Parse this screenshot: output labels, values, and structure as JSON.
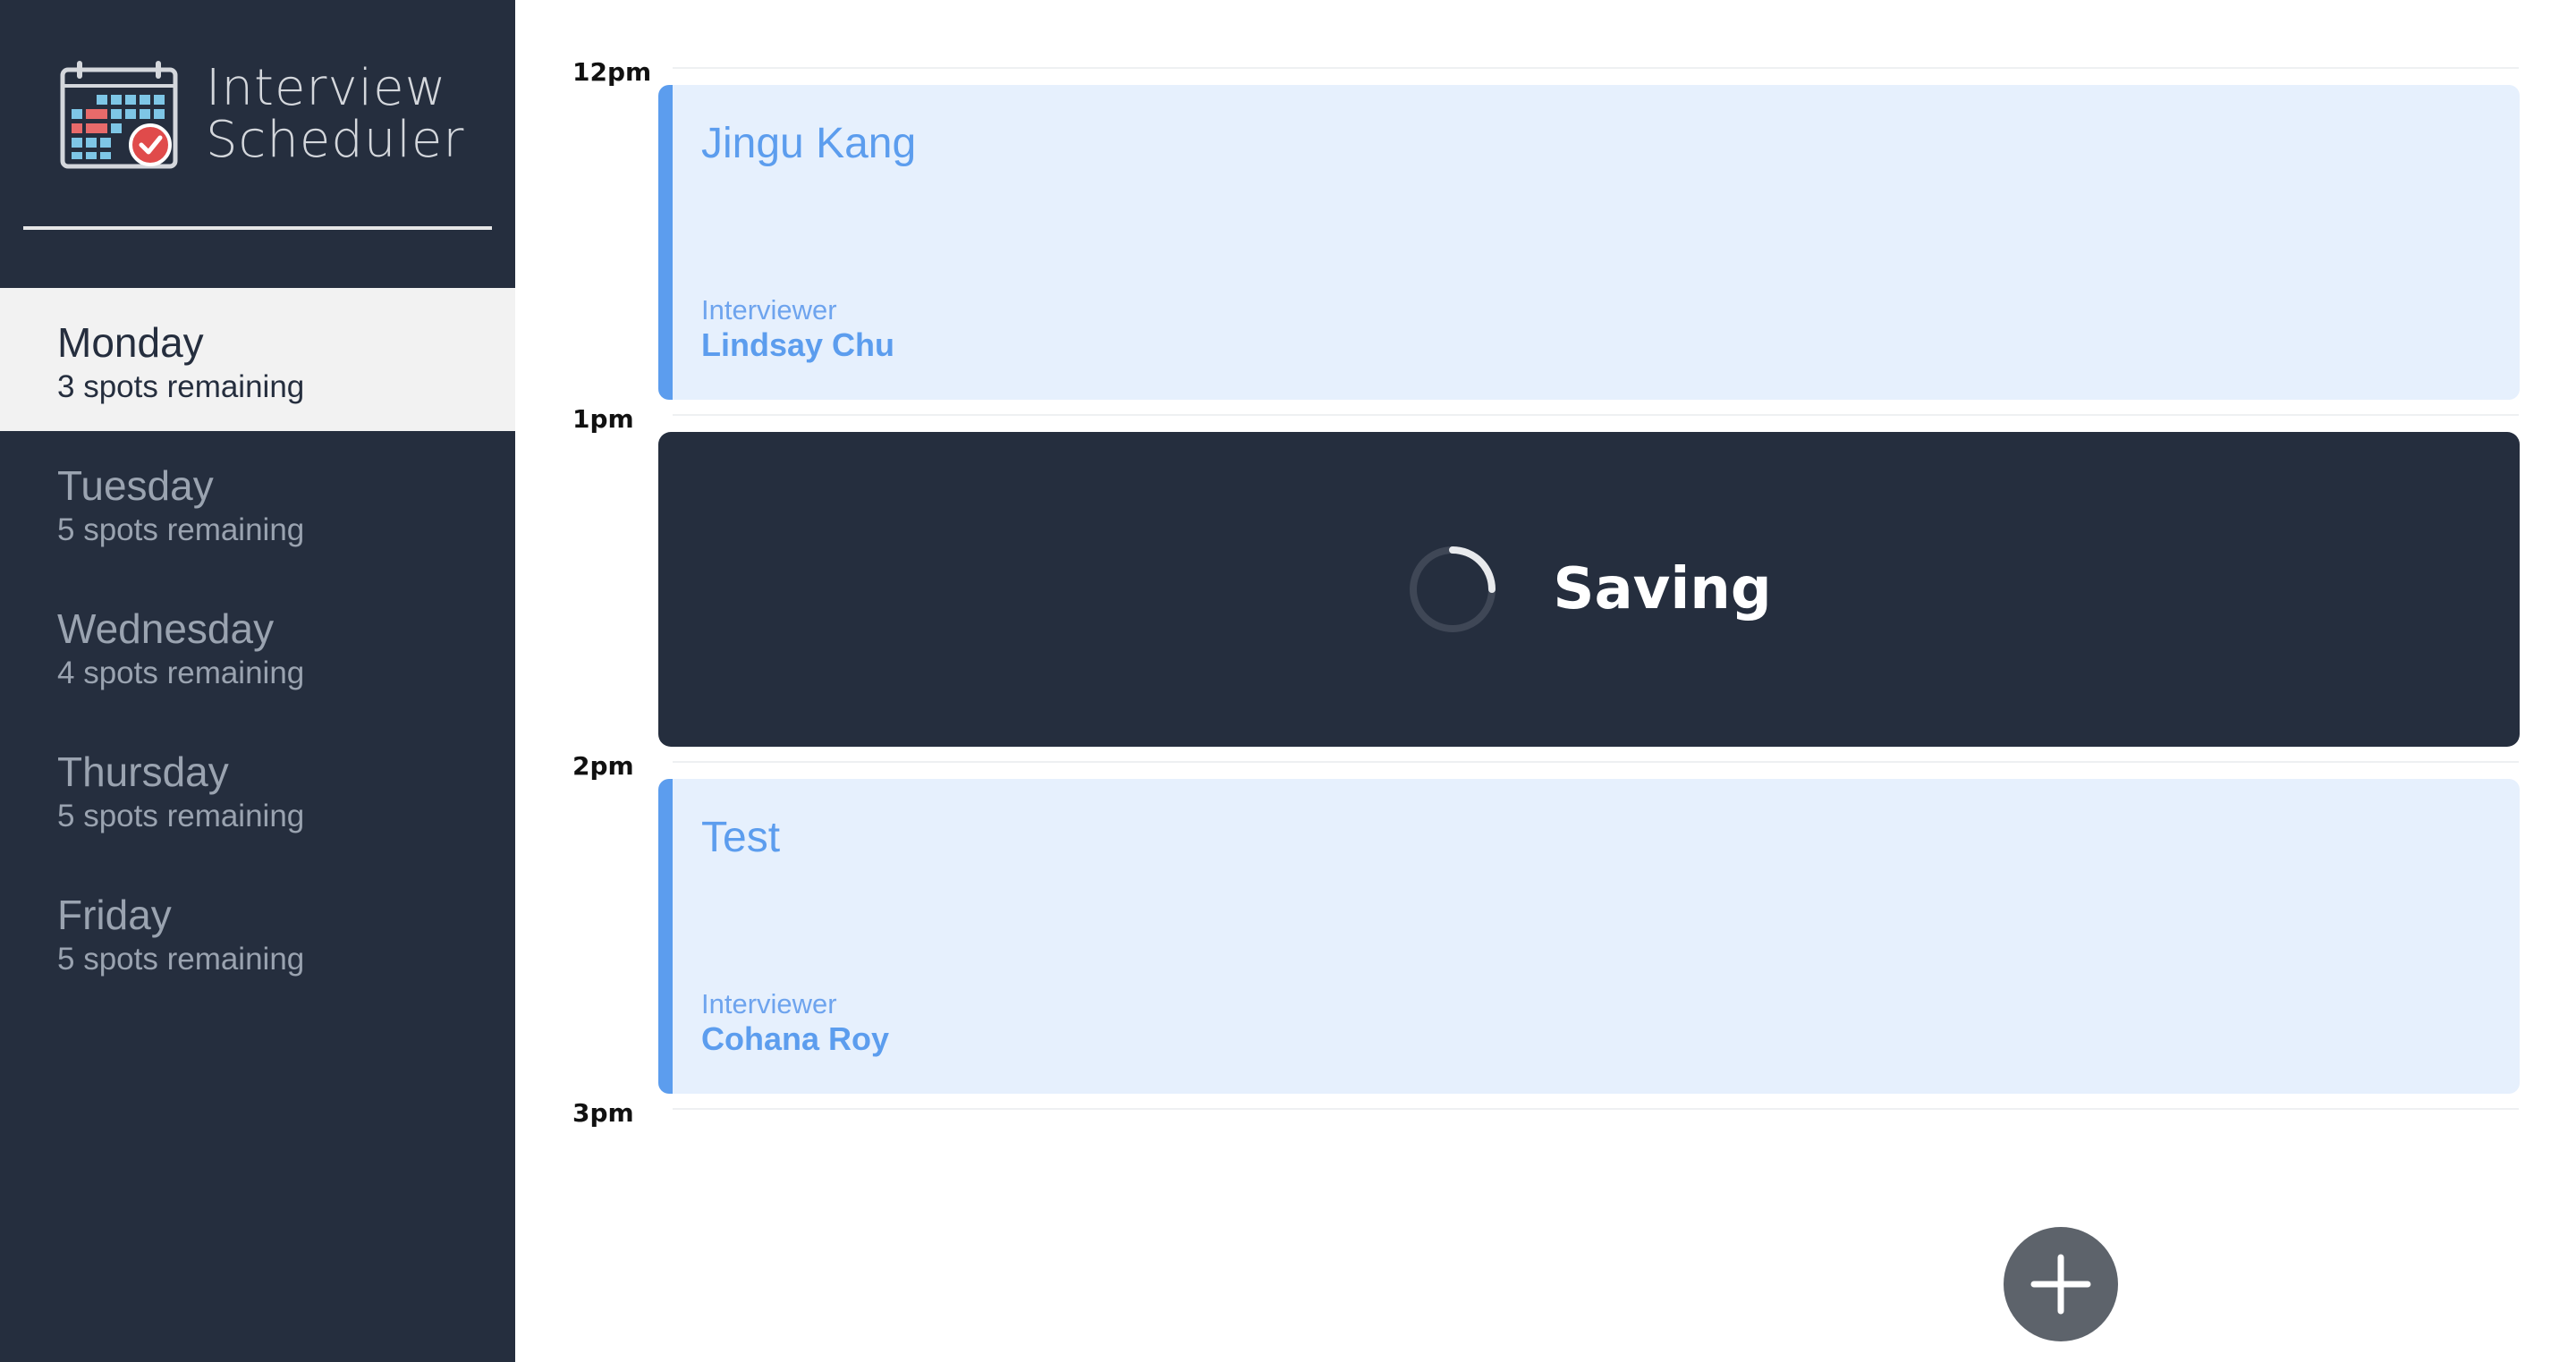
{
  "app": {
    "title_line1": "Interview",
    "title_line2": "Scheduler"
  },
  "sidebar": {
    "days": [
      {
        "name": "Monday",
        "spots": "3 spots remaining",
        "selected": true
      },
      {
        "name": "Tuesday",
        "spots": "5 spots remaining",
        "selected": false
      },
      {
        "name": "Wednesday",
        "spots": "4 spots remaining",
        "selected": false
      },
      {
        "name": "Thursday",
        "spots": "5 spots remaining",
        "selected": false
      },
      {
        "name": "Friday",
        "spots": "5 spots remaining",
        "selected": false
      }
    ]
  },
  "schedule": {
    "times": [
      "12pm",
      "1pm",
      "2pm",
      "3pm"
    ],
    "appointments": [
      {
        "student": "Jingu Kang",
        "interviewer_caption": "Interviewer",
        "interviewer": "Lindsay Chu"
      },
      {
        "status": "Saving"
      },
      {
        "student": "Test",
        "interviewer_caption": "Interviewer",
        "interviewer": "Cohana Roy"
      }
    ]
  },
  "icons": {
    "logo": "calendar-check-icon",
    "spinner": "spinner-icon",
    "add": "plus-icon"
  },
  "colors": {
    "sidebar_bg": "#252e3e",
    "appointment_bg": "#e6f0fd",
    "accent": "#5c9dee",
    "selected_bg": "#f2f2f2",
    "add_button": "#5d636b"
  }
}
